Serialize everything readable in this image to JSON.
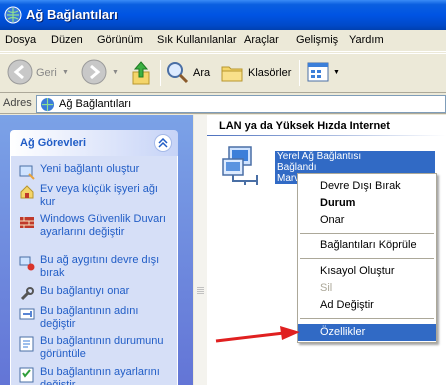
{
  "window": {
    "title": "Ağ Bağlantıları",
    "icon": "network-connections-icon"
  },
  "menubar": {
    "items": [
      "Dosya",
      "Düzen",
      "Görünüm",
      "Sık Kullanılanlar",
      "Araçlar",
      "Gelişmiş",
      "Yardım"
    ]
  },
  "toolbar": {
    "back_label": "Geri",
    "search_label": "Ara",
    "folders_label": "Klasörler"
  },
  "address": {
    "label": "Adres",
    "value": "Ağ Bağlantıları"
  },
  "tasks": {
    "header": "Ağ Görevleri",
    "items": [
      {
        "label": "Yeni bağlantı oluştur",
        "icon": "new-connection-icon"
      },
      {
        "label": "Ev veya küçük işyeri ağı kur",
        "icon": "home-network-icon"
      },
      {
        "label": "Windows Güvenlik Duvarı ayarlarını değiştir",
        "icon": "firewall-icon"
      },
      {
        "label": "Bu ağ aygıtını devre dışı bırak",
        "icon": "disable-device-icon"
      },
      {
        "label": "Bu bağlantıyı onar",
        "icon": "repair-icon"
      },
      {
        "label": "Bu bağlantının adını değiştir",
        "icon": "rename-icon"
      },
      {
        "label": "Bu bağlantının durumunu görüntüle",
        "icon": "status-icon"
      },
      {
        "label": "Bu bağlantının ayarlarını değiştir",
        "icon": "settings-icon"
      }
    ]
  },
  "content": {
    "section_title": "LAN ya da Yüksek Hızda Internet",
    "connection": {
      "name": "Yerel Ağ Bağlantısı",
      "status": "Bağlandı",
      "device": "Marve"
    }
  },
  "context_menu": {
    "items": [
      "Devre Dışı Bırak",
      "Durum",
      "Onar",
      "Bağlantıları Köprüle",
      "Kısayol Oluştur",
      "Sil",
      "Ad Değiştir",
      "Özellikler"
    ],
    "default": "Durum",
    "disabled": "Sil",
    "selected": "Özellikler"
  },
  "colors": {
    "title_bar": "#0054E3",
    "task_pane": "#6375D6",
    "selection": "#316AC5",
    "arrow": "#E02020"
  }
}
